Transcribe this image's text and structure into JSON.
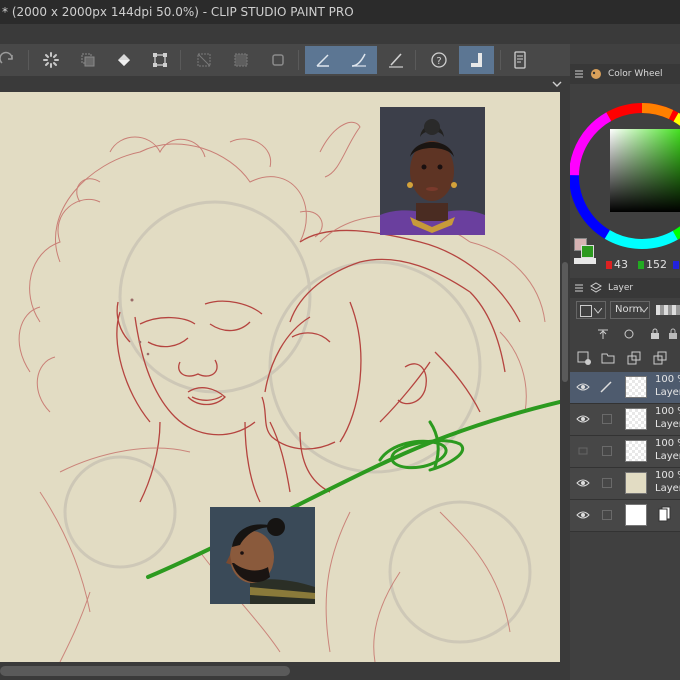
{
  "window": {
    "title": "* (2000 x 2000px 144dpi 50.0%)  - CLIP STUDIO PAINT PRO"
  },
  "toolbar": {
    "buttons": [
      {
        "name": "redo-icon",
        "active": false
      },
      {
        "name": "spinner-icon",
        "active": false
      },
      {
        "name": "copy-icon",
        "active": false
      },
      {
        "name": "fill-bucket-icon",
        "active": false
      },
      {
        "name": "transform-icon",
        "active": false
      },
      {
        "name": "clear-selection-icon",
        "active": false
      },
      {
        "name": "invert-selection-icon",
        "active": false
      },
      {
        "name": "selection-frame-icon",
        "active": false
      },
      {
        "name": "ruler-pen-icon",
        "active": true
      },
      {
        "name": "curve-pen-icon",
        "active": true
      },
      {
        "name": "pen-pressure-icon",
        "active": false
      },
      {
        "name": "help-icon",
        "active": false
      },
      {
        "name": "snap-ruler-icon",
        "active": true
      },
      {
        "name": "device-icon",
        "active": false
      }
    ]
  },
  "panel": {
    "color_wheel_tab": "Color Wheel",
    "rgb": {
      "r": "43",
      "g": "152"
    },
    "layer_tab": "Layer",
    "blend_mode": "Norm",
    "layers": [
      {
        "opacity": "100 %",
        "name": "Layer",
        "selected": true,
        "visible": true,
        "thumb": "transparent-sketch"
      },
      {
        "opacity": "100 %",
        "name": "Layer",
        "selected": false,
        "visible": true,
        "thumb": "transparent-sketch"
      },
      {
        "opacity": "100 %",
        "name": "Layer",
        "selected": false,
        "visible": false,
        "thumb": "transparent-sketch"
      },
      {
        "opacity": "100 %",
        "name": "Layer",
        "selected": false,
        "visible": true,
        "thumb": "beige"
      },
      {
        "opacity": "",
        "name": "",
        "selected": false,
        "visible": true,
        "thumb": "white"
      }
    ]
  },
  "colors": {
    "canvas": "#e2dcc3",
    "sketch": "#b5443f",
    "stroke": "#2c9a1f",
    "accent": "#5c7693"
  }
}
